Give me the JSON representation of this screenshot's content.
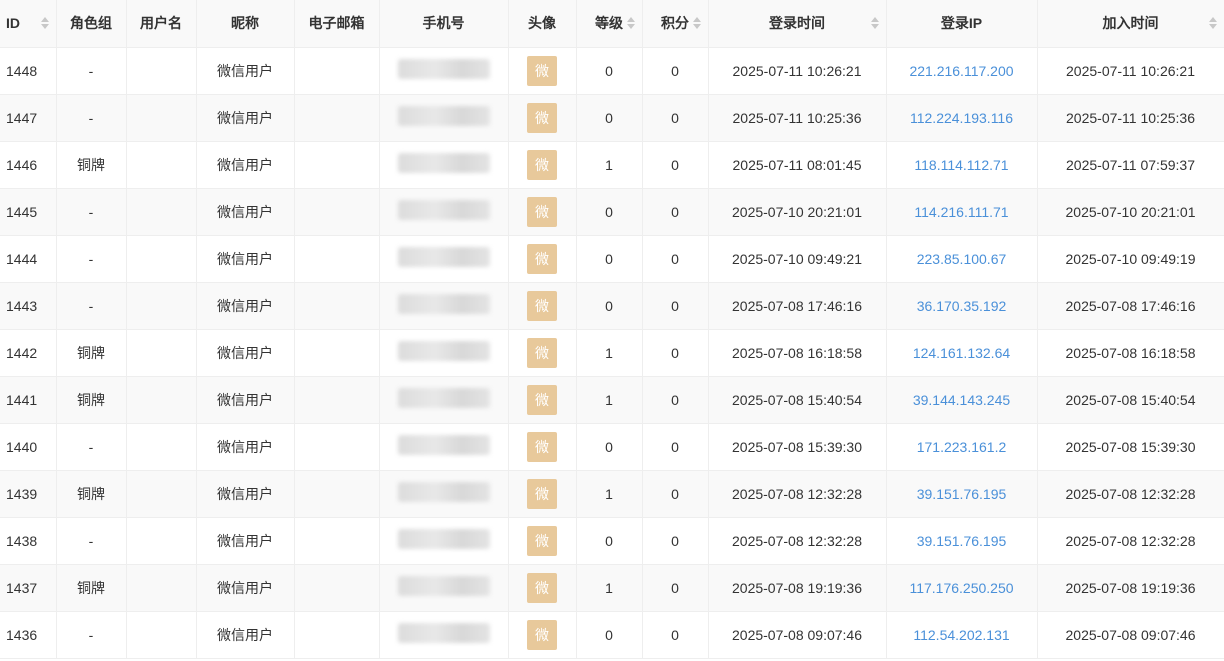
{
  "table": {
    "columns": [
      {
        "key": "id",
        "label": "ID",
        "sortable": true
      },
      {
        "key": "group",
        "label": "角色组",
        "sortable": false
      },
      {
        "key": "username",
        "label": "用户名",
        "sortable": false
      },
      {
        "key": "nickname",
        "label": "昵称",
        "sortable": false
      },
      {
        "key": "email",
        "label": "电子邮箱",
        "sortable": false
      },
      {
        "key": "phone",
        "label": "手机号",
        "sortable": false
      },
      {
        "key": "avatar",
        "label": "头像",
        "sortable": false
      },
      {
        "key": "level",
        "label": "等级",
        "sortable": true
      },
      {
        "key": "score",
        "label": "积分",
        "sortable": true
      },
      {
        "key": "logintime",
        "label": "登录时间",
        "sortable": true
      },
      {
        "key": "loginip",
        "label": "登录IP",
        "sortable": false
      },
      {
        "key": "jointime",
        "label": "加入时间",
        "sortable": true
      }
    ],
    "rows": [
      {
        "id": "1448",
        "group": "-",
        "username": "",
        "nickname": "微信用户",
        "email": "",
        "avatar": "微",
        "level": "0",
        "score": "0",
        "logintime": "2025-07-11 10:26:21",
        "loginip": "221.216.117.200",
        "jointime": "2025-07-11 10:26:21"
      },
      {
        "id": "1447",
        "group": "-",
        "username": "",
        "nickname": "微信用户",
        "email": "",
        "avatar": "微",
        "level": "0",
        "score": "0",
        "logintime": "2025-07-11 10:25:36",
        "loginip": "112.224.193.116",
        "jointime": "2025-07-11 10:25:36"
      },
      {
        "id": "1446",
        "group": "铜牌",
        "username": "",
        "nickname": "微信用户",
        "email": "",
        "avatar": "微",
        "level": "1",
        "score": "0",
        "logintime": "2025-07-11 08:01:45",
        "loginip": "118.114.112.71",
        "jointime": "2025-07-11 07:59:37"
      },
      {
        "id": "1445",
        "group": "-",
        "username": "",
        "nickname": "微信用户",
        "email": "",
        "avatar": "微",
        "level": "0",
        "score": "0",
        "logintime": "2025-07-10 20:21:01",
        "loginip": "114.216.111.71",
        "jointime": "2025-07-10 20:21:01"
      },
      {
        "id": "1444",
        "group": "-",
        "username": "",
        "nickname": "微信用户",
        "email": "",
        "avatar": "微",
        "level": "0",
        "score": "0",
        "logintime": "2025-07-10 09:49:21",
        "loginip": "223.85.100.67",
        "jointime": "2025-07-10 09:49:19"
      },
      {
        "id": "1443",
        "group": "-",
        "username": "",
        "nickname": "微信用户",
        "email": "",
        "avatar": "微",
        "level": "0",
        "score": "0",
        "logintime": "2025-07-08 17:46:16",
        "loginip": "36.170.35.192",
        "jointime": "2025-07-08 17:46:16"
      },
      {
        "id": "1442",
        "group": "铜牌",
        "username": "",
        "nickname": "微信用户",
        "email": "",
        "avatar": "微",
        "level": "1",
        "score": "0",
        "logintime": "2025-07-08 16:18:58",
        "loginip": "124.161.132.64",
        "jointime": "2025-07-08 16:18:58"
      },
      {
        "id": "1441",
        "group": "铜牌",
        "username": "",
        "nickname": "微信用户",
        "email": "",
        "avatar": "微",
        "level": "1",
        "score": "0",
        "logintime": "2025-07-08 15:40:54",
        "loginip": "39.144.143.245",
        "jointime": "2025-07-08 15:40:54"
      },
      {
        "id": "1440",
        "group": "-",
        "username": "",
        "nickname": "微信用户",
        "email": "",
        "avatar": "微",
        "level": "0",
        "score": "0",
        "logintime": "2025-07-08 15:39:30",
        "loginip": "171.223.161.2",
        "jointime": "2025-07-08 15:39:30"
      },
      {
        "id": "1439",
        "group": "铜牌",
        "username": "",
        "nickname": "微信用户",
        "email": "",
        "avatar": "微",
        "level": "1",
        "score": "0",
        "logintime": "2025-07-08 12:32:28",
        "loginip": "39.151.76.195",
        "jointime": "2025-07-08 12:32:28"
      },
      {
        "id": "1438",
        "group": "-",
        "username": "",
        "nickname": "微信用户",
        "email": "",
        "avatar": "微",
        "level": "0",
        "score": "0",
        "logintime": "2025-07-08 12:32:28",
        "loginip": "39.151.76.195",
        "jointime": "2025-07-08 12:32:28"
      },
      {
        "id": "1437",
        "group": "铜牌",
        "username": "",
        "nickname": "微信用户",
        "email": "",
        "avatar": "微",
        "level": "1",
        "score": "0",
        "logintime": "2025-07-08 19:19:36",
        "loginip": "117.176.250.250",
        "jointime": "2025-07-08 19:19:36"
      },
      {
        "id": "1436",
        "group": "-",
        "username": "",
        "nickname": "微信用户",
        "email": "",
        "avatar": "微",
        "level": "0",
        "score": "0",
        "logintime": "2025-07-08 09:07:46",
        "loginip": "112.54.202.131",
        "jointime": "2025-07-08 09:07:46"
      }
    ]
  },
  "icons": {
    "sort": "sort-icon",
    "avatar_placeholder": "wechat-avatar-icon"
  },
  "colors": {
    "link": "#4a90d9",
    "avatar_bg": "#e8c99b",
    "header_bg": "#f9f9f9",
    "stripe_bg": "#f9f9f9",
    "border": "#eeeeee"
  }
}
